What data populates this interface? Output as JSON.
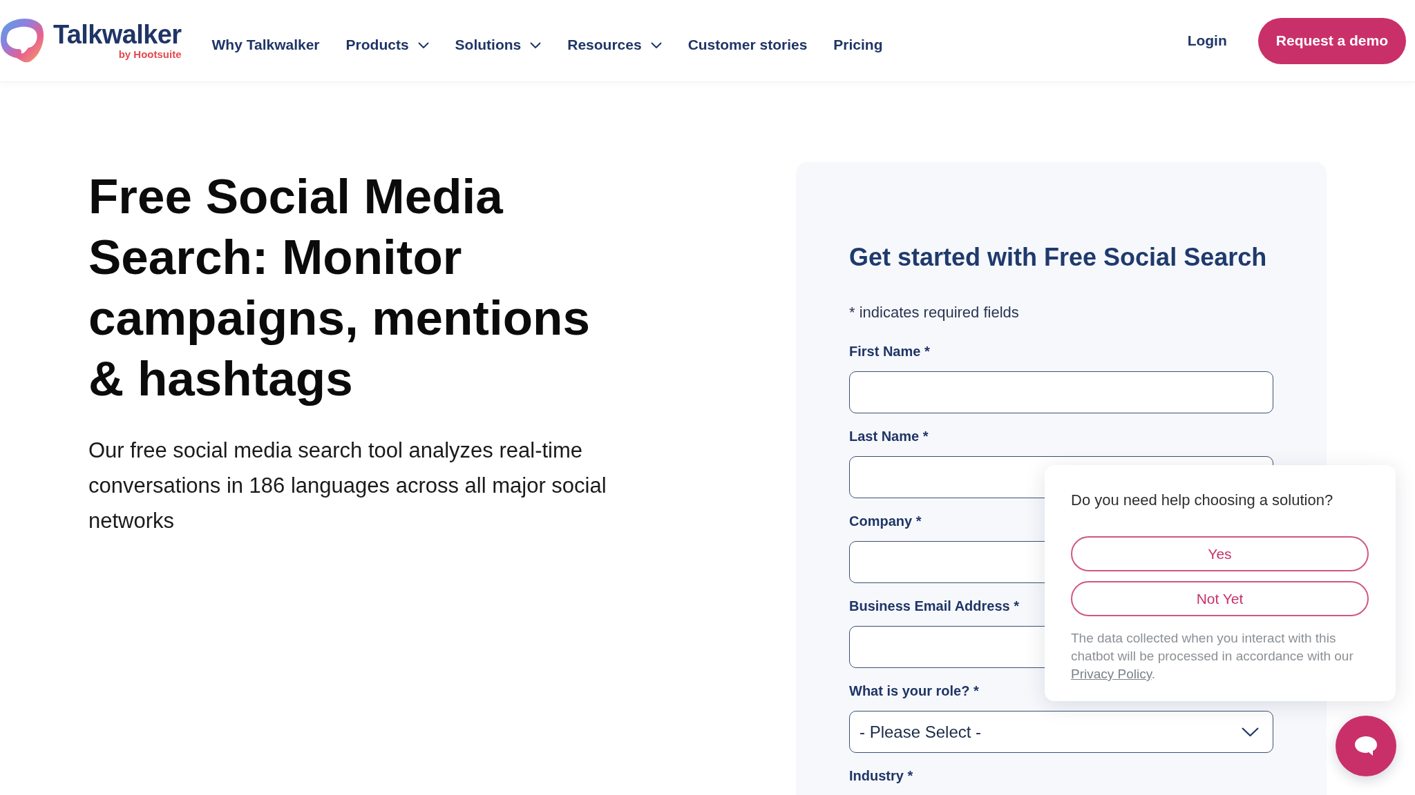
{
  "header": {
    "logo": {
      "name": "Talkwalker",
      "tagline": "by Hootsuite"
    },
    "nav": [
      {
        "label": "Why Talkwalker",
        "dropdown": false
      },
      {
        "label": "Products",
        "dropdown": true
      },
      {
        "label": "Solutions",
        "dropdown": true
      },
      {
        "label": "Resources",
        "dropdown": true
      },
      {
        "label": "Customer stories",
        "dropdown": false
      },
      {
        "label": "Pricing",
        "dropdown": false
      }
    ],
    "login": "Login",
    "cta": "Request a demo"
  },
  "hero": {
    "title": "Free Social Media Search: Monitor campaigns, mentions & hashtags",
    "description": "Our free social media search tool analyzes real-time conversations in 186 languages across all major social networks"
  },
  "form": {
    "title": "Get started with Free Social Search",
    "required_note": "* indicates required fields",
    "fields": [
      {
        "label": "First Name *",
        "kind": "text"
      },
      {
        "label": "Last Name *",
        "kind": "text"
      },
      {
        "label": "Company *",
        "kind": "text"
      },
      {
        "label": "Business Email Address *",
        "kind": "text"
      },
      {
        "label": "What is your role? *",
        "kind": "select",
        "value": "- Please Select -"
      },
      {
        "label": "Industry *",
        "kind": "label"
      }
    ]
  },
  "chat_popup": {
    "question": "Do you need help choosing a solution?",
    "options": [
      "Yes",
      "Not Yet"
    ],
    "disclaimer": "The data collected when you interact with this chatbot will be processed in accordance with our",
    "link": "Privacy Policy",
    "disclaimer_end": "."
  }
}
